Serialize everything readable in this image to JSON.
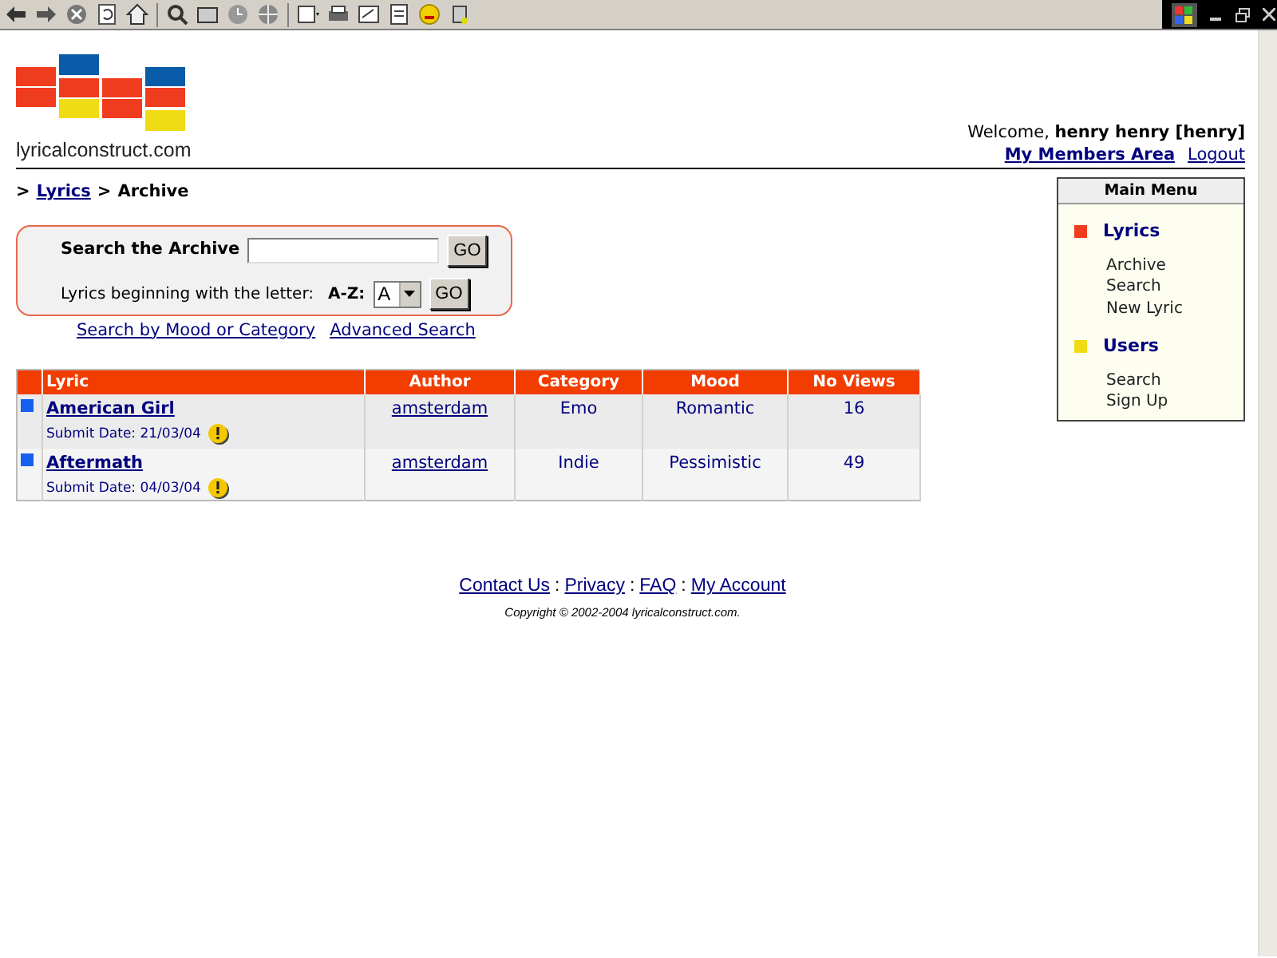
{
  "site": {
    "logo_text": "lyricalconstruct.com"
  },
  "user": {
    "greeting": "Welcome,",
    "name": "henry henry [henry]",
    "links": [
      "My Members Area",
      "Logout"
    ]
  },
  "breadcrumb": {
    "prefix": ">",
    "items": [
      {
        "label": "Lyrics",
        "link": true
      },
      {
        "label": "Archive",
        "link": false
      }
    ],
    "separators": [
      ">"
    ]
  },
  "search": {
    "label": "Search the Archive",
    "button": "GO",
    "letter_label": "Lyrics beginning with the letter:",
    "az_label": "A-Z:",
    "letter_value": "A",
    "letter_button": "GO",
    "links": [
      "Search by Mood or Category",
      "Advanced Search"
    ]
  },
  "table": {
    "columns": [
      "Lyric",
      "Author",
      "Category",
      "Mood",
      "No Views"
    ],
    "rows": [
      {
        "title": "American Girl",
        "submit_date": "Submit Date: 21/03/04",
        "author": "amsterdam",
        "category": "Emo",
        "mood": "Romantic",
        "views": "16"
      },
      {
        "title": "Aftermath",
        "submit_date": "Submit Date: 04/03/04",
        "author": "amsterdam",
        "category": "Indie",
        "mood": "Pessimistic",
        "views": "49"
      }
    ]
  },
  "menu": {
    "title": "Main Menu",
    "sections": [
      {
        "title": "Lyrics",
        "color": "#f03c1e",
        "items": [
          "Archive",
          "Search",
          "New Lyric"
        ]
      },
      {
        "title": "Users",
        "color": "#f0dc14",
        "items": [
          "Search",
          "Sign Up"
        ]
      }
    ]
  },
  "footer": {
    "links": [
      "Contact Us",
      "Privacy",
      "FAQ",
      "My Account"
    ],
    "separators": [
      ":",
      ":",
      ":"
    ],
    "copyright": "Copyright © 2002-2004 lyricalconstruct.com."
  }
}
